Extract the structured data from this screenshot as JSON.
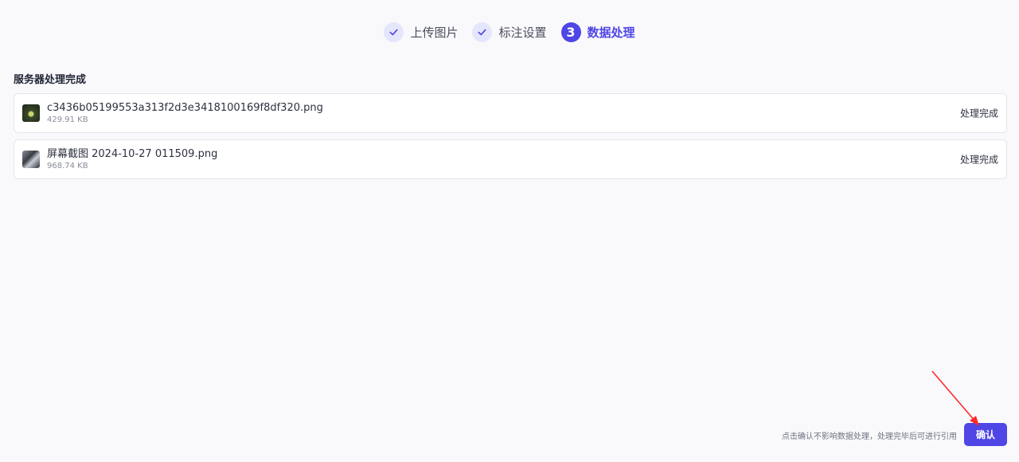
{
  "stepper": {
    "steps": [
      {
        "label": "上传图片",
        "state": "done"
      },
      {
        "label": "标注设置",
        "state": "done"
      },
      {
        "label": "数据处理",
        "state": "active",
        "number": "3"
      }
    ]
  },
  "section": {
    "title": "服务器处理完成"
  },
  "files": [
    {
      "name": "c3436b05199553a313f2d3e3418100169f8df320.png",
      "size": "429.91 KB",
      "status": "处理完成"
    },
    {
      "name": "屏幕截图 2024-10-27 011509.png",
      "size": "968.74 KB",
      "status": "处理完成"
    }
  ],
  "footer": {
    "hint": "点击确认不影响数据处理，处理完毕后可进行引用",
    "confirm_label": "确认"
  },
  "colors": {
    "accent": "#4f46e5",
    "annotation_arrow": "#ff2a2a"
  }
}
